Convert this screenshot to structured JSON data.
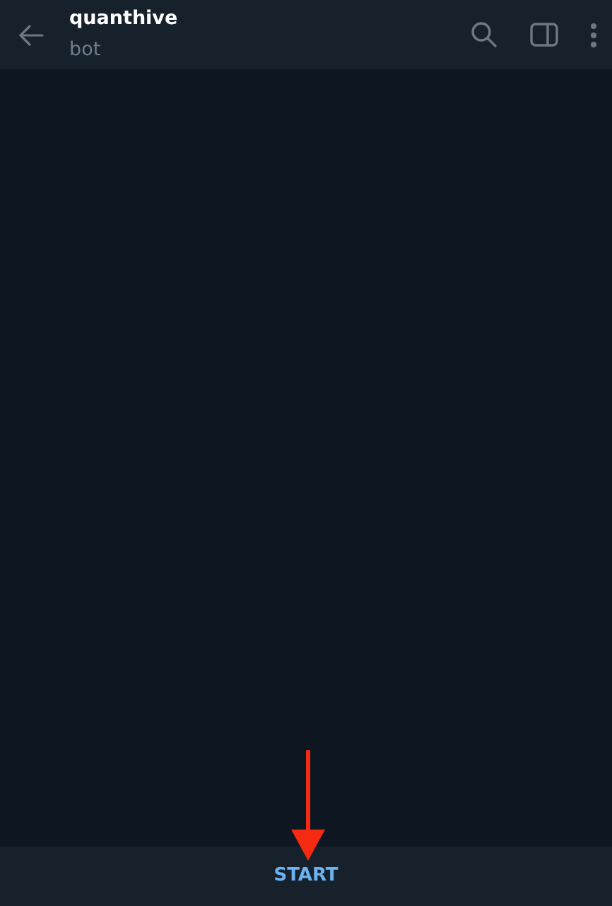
{
  "header": {
    "title": "quanthive",
    "subtitle": "bot"
  },
  "bottom_bar": {
    "button": "START"
  }
}
